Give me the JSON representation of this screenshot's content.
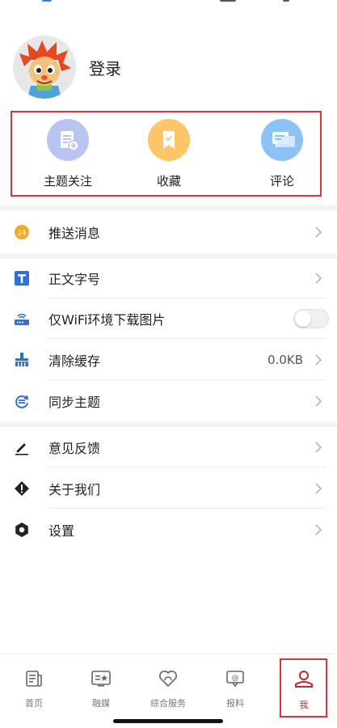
{
  "profile": {
    "login_label": "登录"
  },
  "quick_actions": [
    {
      "label": "主题关注",
      "icon": "topic-follow-icon",
      "color": "#b9c4f2"
    },
    {
      "label": "收藏",
      "icon": "bookmark-icon",
      "color": "#ffc667"
    },
    {
      "label": "评论",
      "icon": "comment-icon",
      "color": "#8cc3f7"
    }
  ],
  "menu": {
    "push": {
      "label": "推送消息",
      "badge": "24"
    },
    "font_size": {
      "label": "正文字号"
    },
    "wifi_only": {
      "label": "仅WiFi环境下载图片",
      "enabled": false
    },
    "clear_cache": {
      "label": "清除缓存",
      "value": "0.0KB"
    },
    "sync_theme": {
      "label": "同步主题"
    },
    "feedback": {
      "label": "意见反馈"
    },
    "about": {
      "label": "关于我们"
    },
    "settings": {
      "label": "设置"
    }
  },
  "tabbar": [
    {
      "label": "首页",
      "icon": "home-news-icon"
    },
    {
      "label": "融媒",
      "icon": "media-icon"
    },
    {
      "label": "综合服务",
      "icon": "service-heart-icon"
    },
    {
      "label": "报料",
      "icon": "report-icon"
    },
    {
      "label": "我",
      "icon": "user-icon",
      "active": true
    }
  ],
  "colors": {
    "accent": "#c2272d",
    "highlight_box": "#d9363e",
    "icon_blue": "#2f6fd6"
  }
}
